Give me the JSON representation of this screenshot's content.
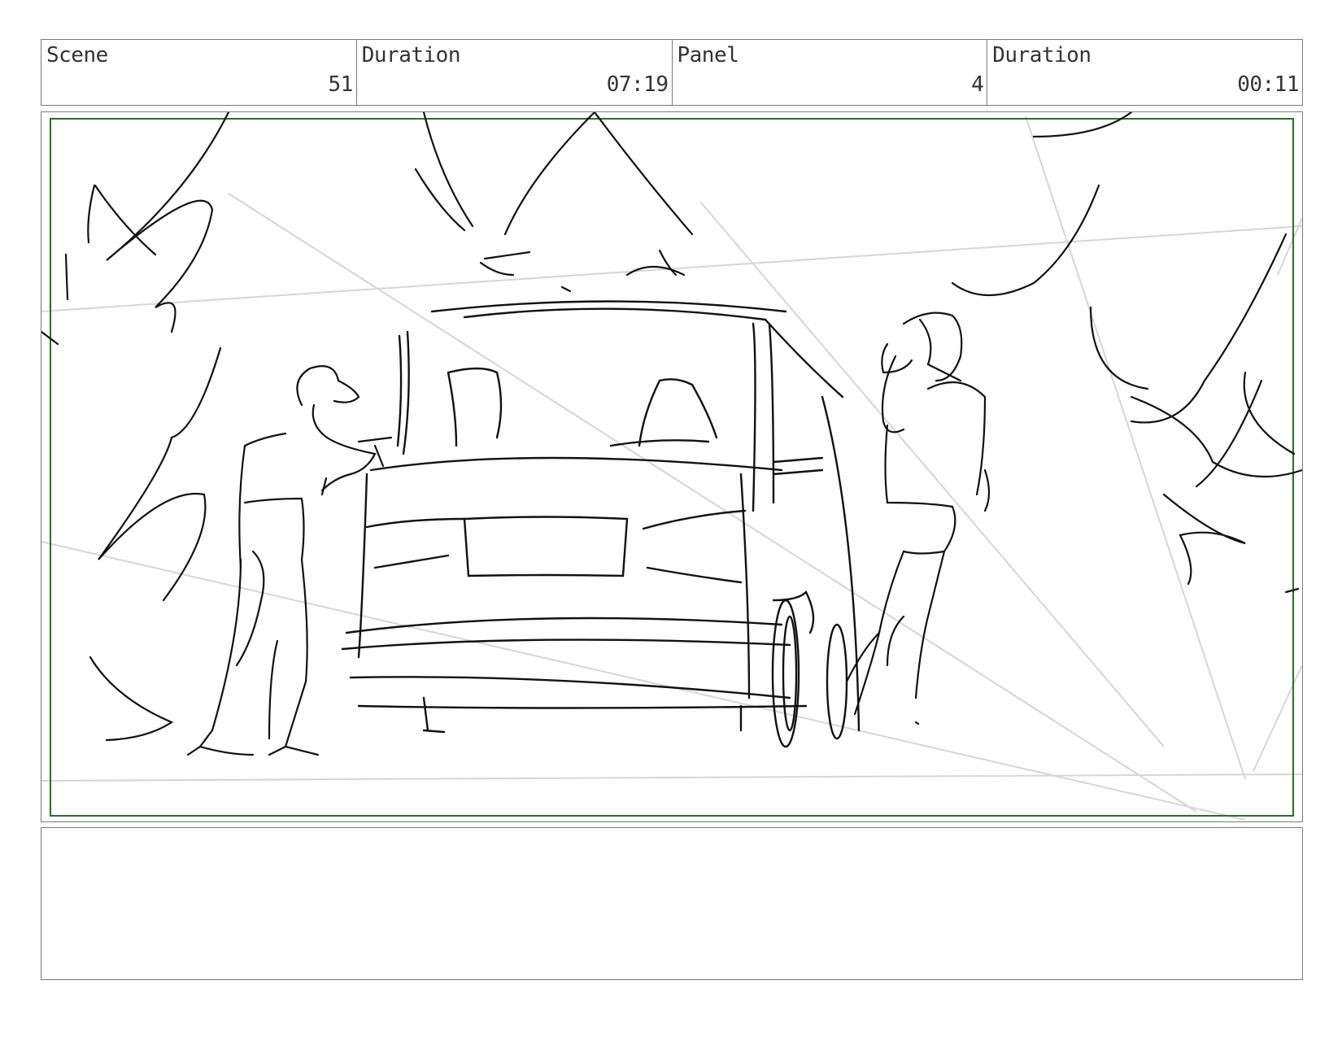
{
  "header": {
    "scene": {
      "label": "Scene",
      "value": "51"
    },
    "scene_duration": {
      "label": "Duration",
      "value": "07:19"
    },
    "panel": {
      "label": "Panel",
      "value": "4"
    },
    "panel_duration": {
      "label": "Duration",
      "value": "00:11"
    }
  },
  "colors": {
    "frame_border": "#7a7a7a",
    "safe_area": "#2e6b2e",
    "sketch_line": "#111111",
    "guide_line": "#d6d6d6"
  },
  "notes": {
    "text": ""
  }
}
